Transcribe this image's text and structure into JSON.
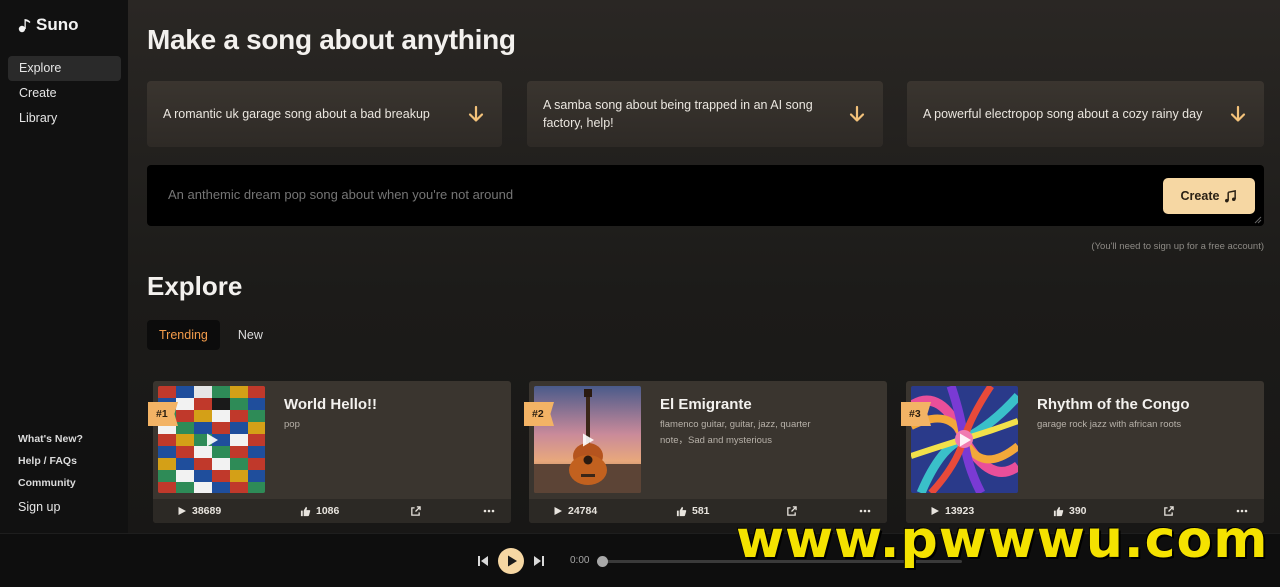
{
  "app": {
    "name": "Suno"
  },
  "sidebar": {
    "items": [
      {
        "label": "Explore",
        "active": true
      },
      {
        "label": "Create",
        "active": false
      },
      {
        "label": "Library",
        "active": false
      }
    ],
    "bottom_links": [
      {
        "label": "What's New?"
      },
      {
        "label": "Help / FAQs"
      },
      {
        "label": "Community"
      }
    ],
    "signup_label": "Sign up"
  },
  "main": {
    "headline": "Make a song about anything",
    "suggestions": [
      {
        "text": "A romantic uk garage song about a bad breakup",
        "icon": "arrow-down-icon"
      },
      {
        "text": "A samba song about being trapped in an AI song factory, help!",
        "icon": "arrow-down-icon"
      },
      {
        "text": "A powerful electropop song about a cozy rainy day",
        "icon": "arrow-down-icon"
      }
    ],
    "prompt": {
      "placeholder": "An anthemic dream pop song about when you're not around",
      "value": "",
      "create_label": "Create",
      "create_icon": "music-note-icon"
    },
    "signup_note": "(You'll need to sign up for a free account)"
  },
  "explore": {
    "title": "Explore",
    "tabs": [
      {
        "label": "Trending",
        "active": true
      },
      {
        "label": "New",
        "active": false
      }
    ],
    "songs": [
      {
        "rank": "#1",
        "title": "World Hello!!",
        "tags": "pop",
        "plays": "38689",
        "likes": "1086",
        "thumb": "flags-collage"
      },
      {
        "rank": "#2",
        "title": "El Emigrante",
        "tags": "flamenco guitar, guitar, jazz, quarter note，Sad and mysterious",
        "plays": "24784",
        "likes": "581",
        "thumb": "guitar-sunset"
      },
      {
        "rank": "#3",
        "title": "Rhythm of the Congo",
        "tags": "garage rock jazz with african roots",
        "plays": "13923",
        "likes": "390",
        "thumb": "colorful-swirl"
      }
    ]
  },
  "player": {
    "current_time": "0:00"
  },
  "watermark": "www.pwwwu.com",
  "colors": {
    "accent": "#f6d7a3",
    "trending_tab": "#f29b4a",
    "rank_badge": "#f3b365",
    "watermark": "#f4e200"
  }
}
